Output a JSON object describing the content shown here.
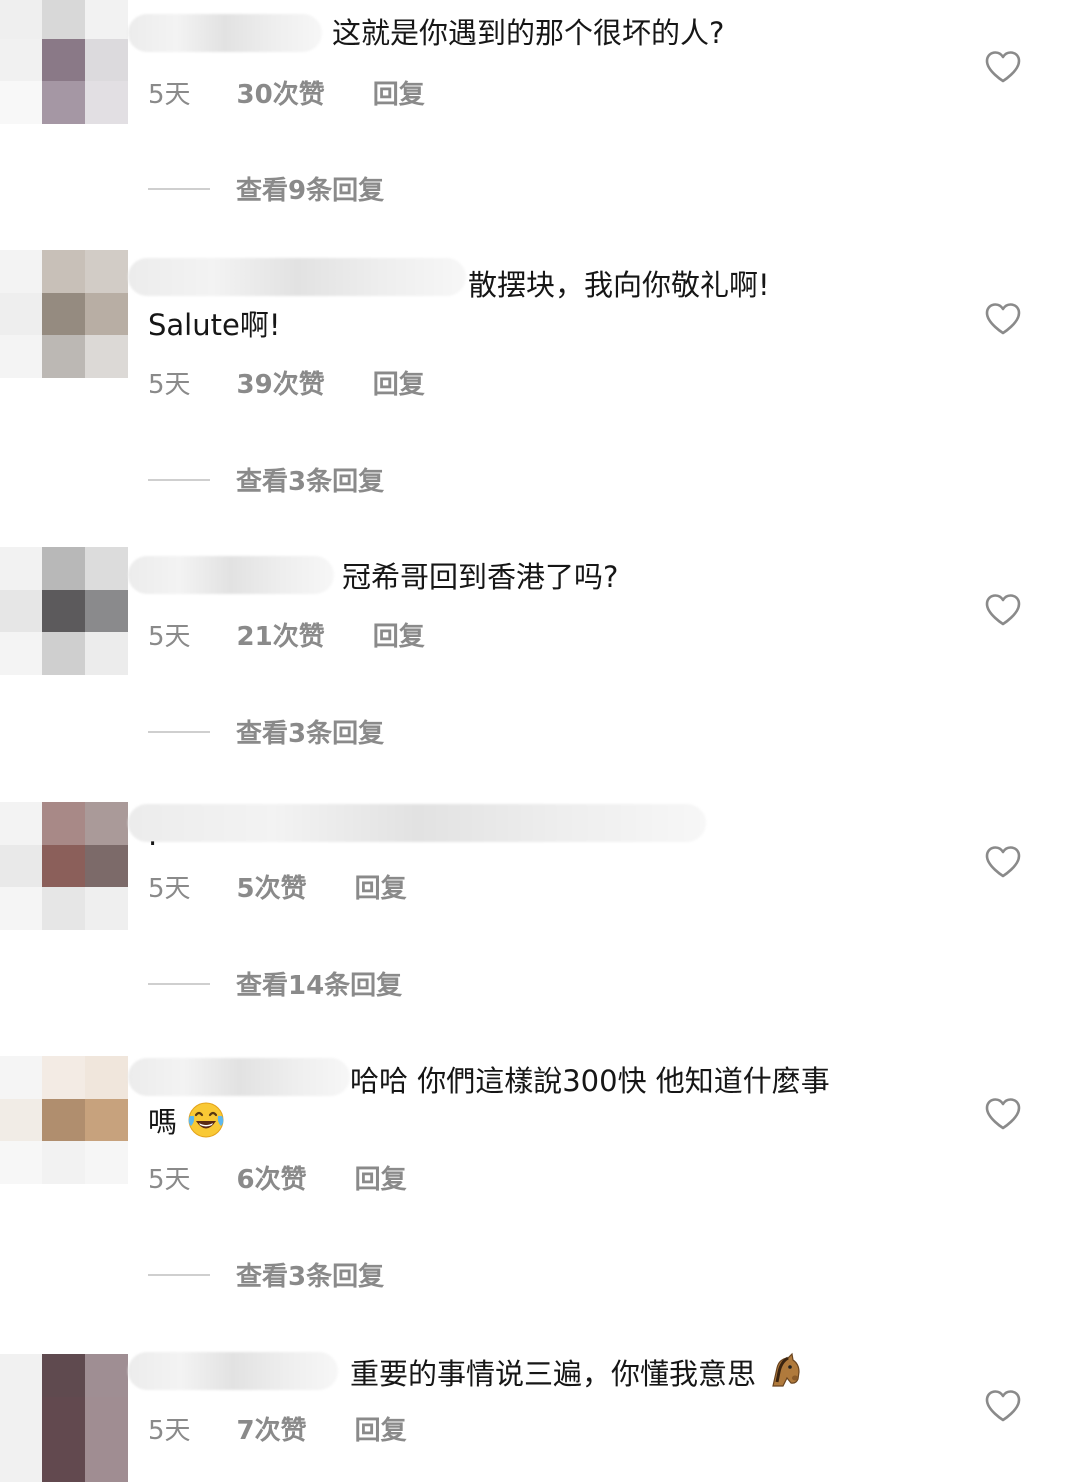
{
  "comments": [
    {
      "text": "这就是你遇到的那个很坏的人?",
      "time": "5天",
      "likes": "30次赞",
      "reply": "回复",
      "view_replies": "查看9条回复",
      "avatar_colors": [
        "#efefef",
        "#d8d8d8",
        "#f2f2f2",
        "#f1f1f1",
        "#8a7987",
        "#dcdadd",
        "#f8f8f8",
        "#a597a4",
        "#e2dfe3"
      ]
    },
    {
      "text": "散摆块，我向你敬礼啊!",
      "text2": "Salute啊!",
      "time": "5天",
      "likes": "39次赞",
      "reply": "回复",
      "view_replies": "查看3条回复",
      "avatar_colors": [
        "#f3f3f3",
        "#c8c0b8",
        "#d2ccc6",
        "#eeeeee",
        "#958b80",
        "#b8aea4",
        "#f4f4f4",
        "#bcb8b4",
        "#dcd9d6"
      ]
    },
    {
      "text": "冠希哥回到香港了吗?",
      "time": "5天",
      "likes": "21次赞",
      "reply": "回复",
      "view_replies": "查看3条回复",
      "avatar_colors": [
        "#f2f2f2",
        "#b8b8b8",
        "#dcdcdc",
        "#e6e6e6",
        "#5c5a5c",
        "#8a8a8c",
        "#f4f4f4",
        "#cfcfcf",
        "#ececec"
      ]
    },
    {
      "text": ".",
      "time": "5天",
      "likes": "5次赞",
      "reply": "回复",
      "view_replies": "查看14条回复",
      "avatar_colors": [
        "#f3f3f3",
        "#a88987",
        "#aa9a99",
        "#e9e9e9",
        "#8b5f5a",
        "#7c6a69",
        "#f5f5f5",
        "#e6e6e6",
        "#efefef"
      ]
    },
    {
      "text": "哈哈 你們這樣說300快 他知道什麼事",
      "text2": "嗎",
      "time": "5天",
      "likes": "6次赞",
      "reply": "回复",
      "view_replies": "查看3条回复",
      "avatar_colors": [
        "#f5f5f5",
        "#f3ebe4",
        "#f0e6dc",
        "#f1ece6",
        "#b08e6e",
        "#c7a27d",
        "#f7f7f7",
        "#f2f2f2",
        "#f6f6f6"
      ]
    },
    {
      "text": "重要的事情说三遍，你懂我意思",
      "time": "5天",
      "likes": "7次赞",
      "reply": "回复",
      "avatar_colors": [
        "#f1f1f1",
        "#5f4a4f",
        "#9f8e93",
        "#f1f1f1",
        "#62494f",
        "#a08d92",
        "#f1f1f1",
        "#62494f",
        "#a08d92"
      ]
    }
  ],
  "icons": {
    "like": "heart-outline-icon",
    "laugh": "tears-of-joy-emoji",
    "horse": "horse-face-emoji"
  },
  "colors": {
    "meta_gray": "#8a8a8a",
    "text": "#161616",
    "background": "#ffffff"
  }
}
